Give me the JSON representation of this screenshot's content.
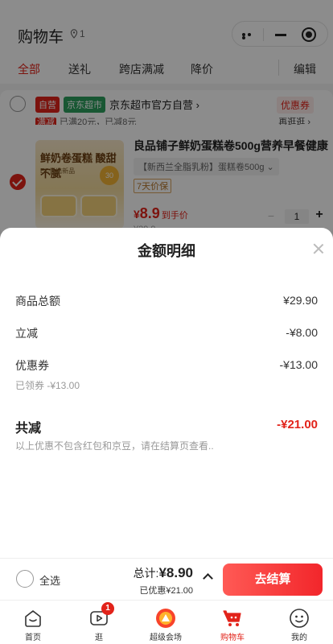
{
  "header": {
    "title": "购物车",
    "location_count": "1"
  },
  "tabs": [
    {
      "label": "全部",
      "active": true
    },
    {
      "label": "送礼",
      "active": false
    },
    {
      "label": "跨店满减",
      "active": false
    },
    {
      "label": "降价",
      "active": false
    }
  ],
  "edit_label": "编辑",
  "shop": {
    "tag_self": "自营",
    "tag_supermarket": "京东超市",
    "name": "京东超市官方自营 ›",
    "coupon_label": "优惠券",
    "promo_tag": "满减",
    "promo_text": "已满20元，已减8元",
    "promo_more": "再逛逛 ›"
  },
  "product": {
    "image_title": "鲜奶卷蛋糕 酸甜不腻",
    "image_sub": "EC优选新品",
    "image_badge": "30",
    "title": "良品铺子鲜奶蛋糕卷500g营养早餐健康",
    "spec": "【新西兰全脂乳粉】蛋糕卷500g ⌄",
    "guarantee": "7天价保",
    "price_symbol": "¥",
    "price": "8.9",
    "price_note": "到手价",
    "quantity": "1",
    "old_price": "¥29.9"
  },
  "sheet": {
    "title": "金额明细",
    "rows": [
      {
        "label": "商品总额",
        "value": "¥29.90"
      },
      {
        "label": "立减",
        "value": "-¥8.00"
      },
      {
        "label": "优惠券",
        "value": "-¥13.00"
      }
    ],
    "coupon_sub": "已领券 -¥13.00",
    "total_label": "共减",
    "total_value": "-¥21.00",
    "note": "以上优惠不包含红包和京豆，请在结算页查看.."
  },
  "checkout": {
    "select_all": "全选",
    "total_prefix": "总计:",
    "total_amount": "¥8.90",
    "saved": "已优惠¥21.00",
    "button": "去结算"
  },
  "tabbar": [
    {
      "label": "首页",
      "icon": "home-icon"
    },
    {
      "label": "逛",
      "icon": "video-icon",
      "badge": "1"
    },
    {
      "label": "超级会场",
      "icon": "venue-icon"
    },
    {
      "label": "购物车",
      "icon": "cart-icon",
      "active": true
    },
    {
      "label": "我的",
      "icon": "profile-icon"
    }
  ],
  "colors": {
    "brand_red": "#e2231a",
    "supermarket_green": "#2c9f5e"
  }
}
